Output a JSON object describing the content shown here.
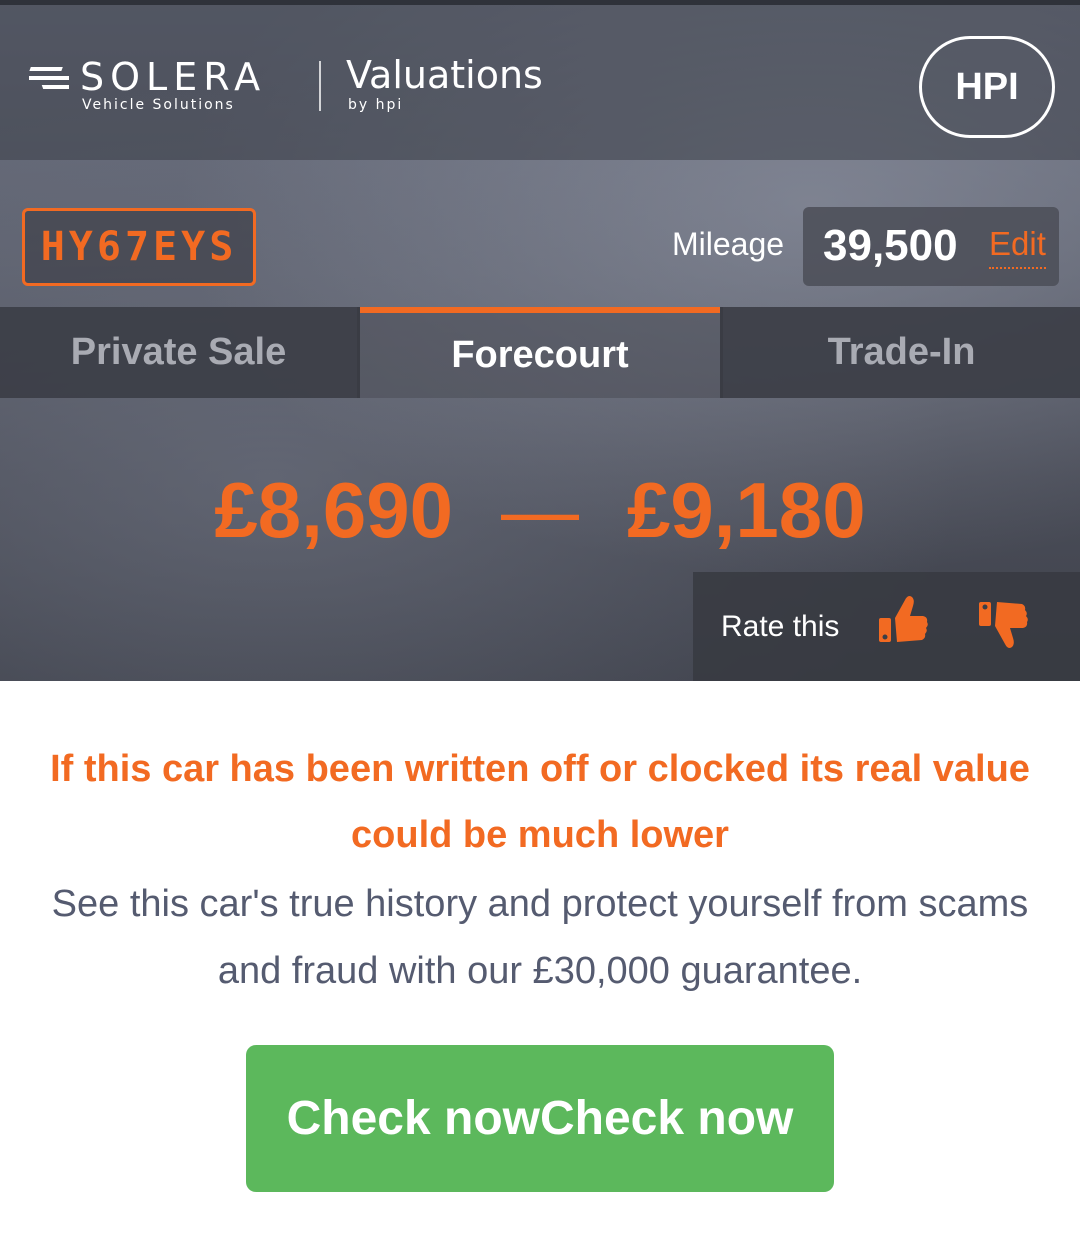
{
  "header": {
    "brand": "SOLERA",
    "brand_sub": "Vehicle Solutions",
    "product": "Valuations",
    "product_sub": "by hpi",
    "hpi_button": "HPI"
  },
  "vehicle": {
    "registration": "HY67EYS",
    "mileage_label": "Mileage",
    "mileage_value": "39,500",
    "edit_label": "Edit"
  },
  "tabs": [
    {
      "label": "Private Sale",
      "active": false
    },
    {
      "label": "Forecourt",
      "active": true
    },
    {
      "label": "Trade-In",
      "active": false
    }
  ],
  "valuation": {
    "low": "£8,690",
    "separator": "—",
    "high": "£9,180"
  },
  "rating": {
    "label": "Rate this",
    "up_icon": "thumbs-up-icon",
    "down_icon": "thumbs-down-icon"
  },
  "promo": {
    "warning": "If this car has been written off or clocked its real value could be much lower",
    "info": "See this car's true history and protect yourself from scams and fraud with our £30,000 guarantee.",
    "cta": "Check nowCheck now"
  },
  "colors": {
    "accent": "#f26a22",
    "cta": "#5cb85c",
    "info_text": "#555b70"
  }
}
